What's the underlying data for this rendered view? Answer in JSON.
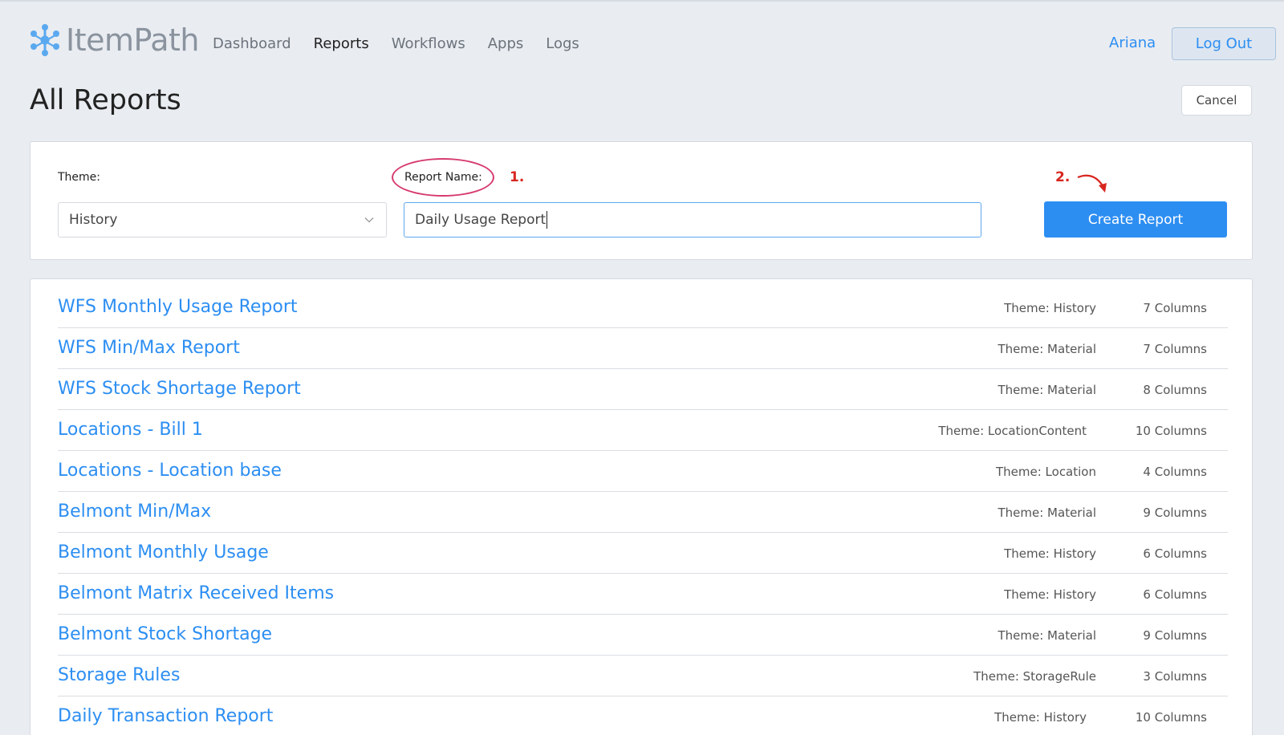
{
  "app": {
    "name": "ItemPath"
  },
  "nav": {
    "items": [
      "Dashboard",
      "Reports",
      "Workflows",
      "Apps",
      "Logs"
    ],
    "active": "Reports"
  },
  "user": {
    "name": "Ariana",
    "logout_label": "Log Out"
  },
  "page": {
    "title": "All Reports",
    "cancel_label": "Cancel"
  },
  "form": {
    "theme_label": "Theme:",
    "theme_value": "History",
    "name_label": "Report Name:",
    "name_value": "Daily Usage Report",
    "create_label": "Create Report",
    "annotation_1": "1.",
    "annotation_2": "2."
  },
  "reports": [
    {
      "name": "WFS Monthly Usage Report",
      "theme": "Theme: History",
      "columns": "7 Columns"
    },
    {
      "name": "WFS Min/Max Report",
      "theme": "Theme: Material",
      "columns": "7 Columns"
    },
    {
      "name": "WFS Stock Shortage Report",
      "theme": "Theme: Material",
      "columns": "8 Columns"
    },
    {
      "name": "Locations - Bill 1",
      "theme": "Theme: LocationContent",
      "columns": "10 Columns"
    },
    {
      "name": "Locations - Location base",
      "theme": "Theme: Location",
      "columns": "4 Columns"
    },
    {
      "name": "Belmont Min/Max",
      "theme": "Theme: Material",
      "columns": "9 Columns"
    },
    {
      "name": "Belmont Monthly Usage",
      "theme": "Theme: History",
      "columns": "6 Columns"
    },
    {
      "name": "Belmont Matrix Received Items",
      "theme": "Theme: History",
      "columns": "6 Columns"
    },
    {
      "name": "Belmont Stock Shortage",
      "theme": "Theme: Material",
      "columns": "9 Columns"
    },
    {
      "name": "Storage Rules",
      "theme": "Theme: StorageRule",
      "columns": "3 Columns"
    },
    {
      "name": "Daily Transaction Report",
      "theme": "Theme: History",
      "columns": "10 Columns"
    }
  ],
  "colors": {
    "accent": "#2d8ef2",
    "annotation": "#d8261f",
    "background": "#e9ecf1"
  }
}
